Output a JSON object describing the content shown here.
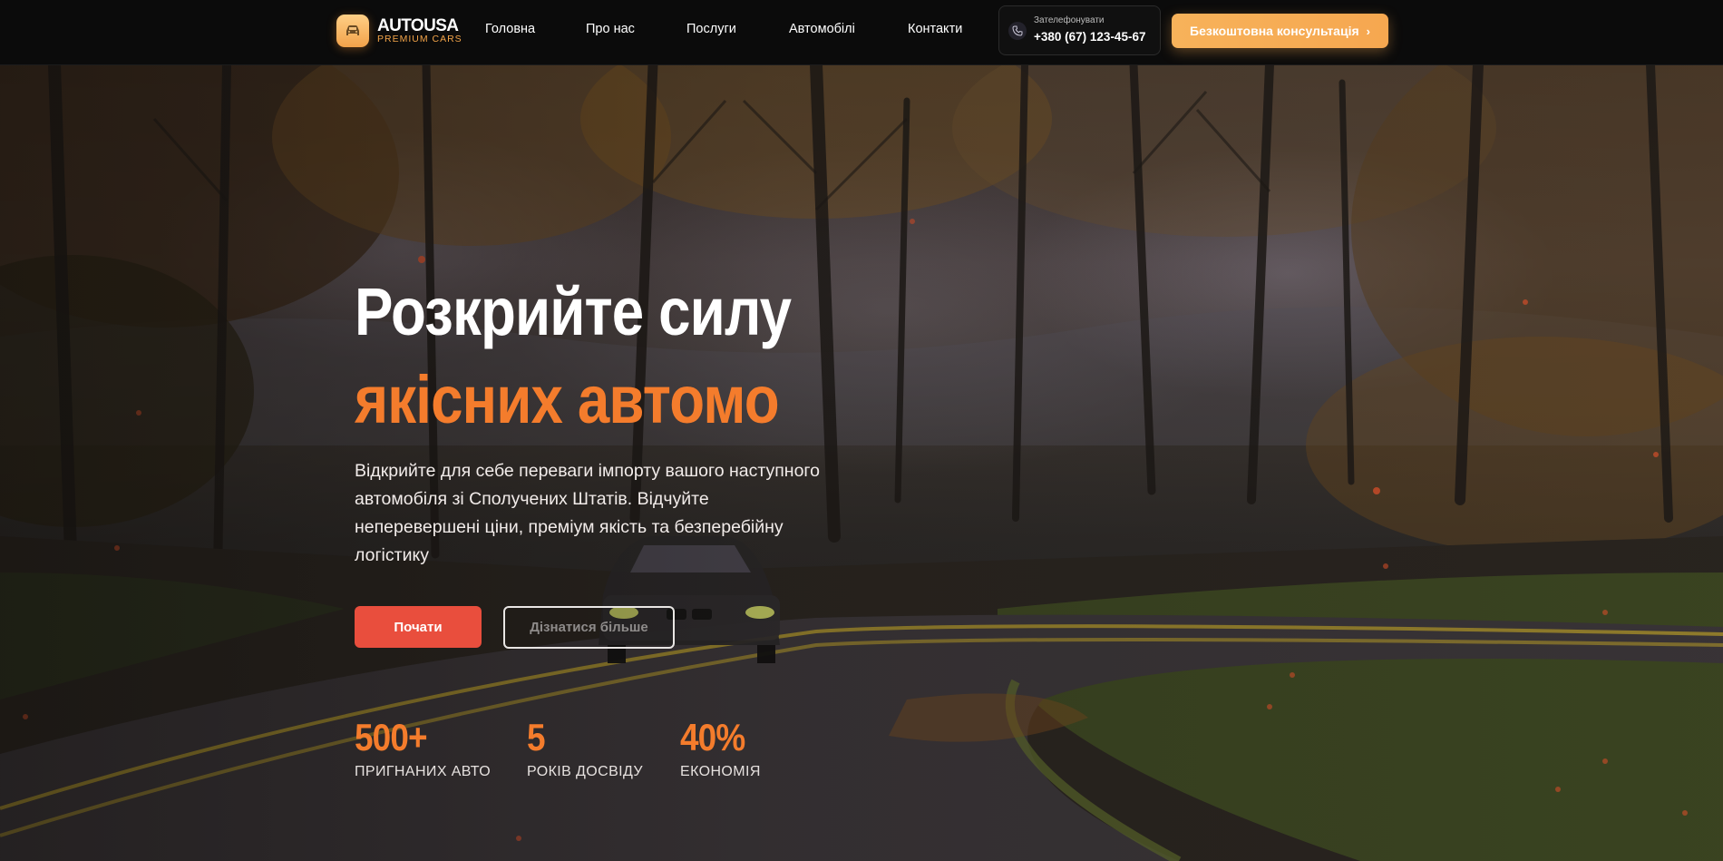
{
  "header": {
    "logo": {
      "title": "AUTOUSA",
      "subtitle": "PREMIUM CARS",
      "icon": "car-icon"
    },
    "nav": [
      {
        "label": "Головна"
      },
      {
        "label": "Про нас"
      },
      {
        "label": "Послуги"
      },
      {
        "label": "Автомобілі"
      },
      {
        "label": "Контакти"
      }
    ],
    "phone": {
      "label": "Зателефонувати",
      "number": "+380 (67) 123-45-67",
      "icon": "phone-icon"
    },
    "cta": {
      "label": "Безкоштовна консультація",
      "icon": "chevron-right-icon"
    }
  },
  "hero": {
    "headline_line1": "Розкрийте силу",
    "headline_line2": "якісних автомо",
    "description": "Відкрийте для себе переваги імпорту вашого наступного автомобіля зі Сполучених Штатів. Відчуйте неперевершені ціни, преміум якість та безперебійну логістику",
    "primary_button": "Почати",
    "secondary_button": "Дізнатися більше",
    "stats": [
      {
        "value": "500+",
        "label": "ПРИГНАНИХ АВТО"
      },
      {
        "value": "5",
        "label": "РОКІВ ДОСВІДУ"
      },
      {
        "value": "40%",
        "label": "ЕКОНОМІЯ"
      }
    ]
  },
  "colors": {
    "accent": "#f47c2c",
    "cta": "#f7b25a",
    "primary_button": "#e94e3d",
    "header_bg": "#0b0b0b"
  }
}
